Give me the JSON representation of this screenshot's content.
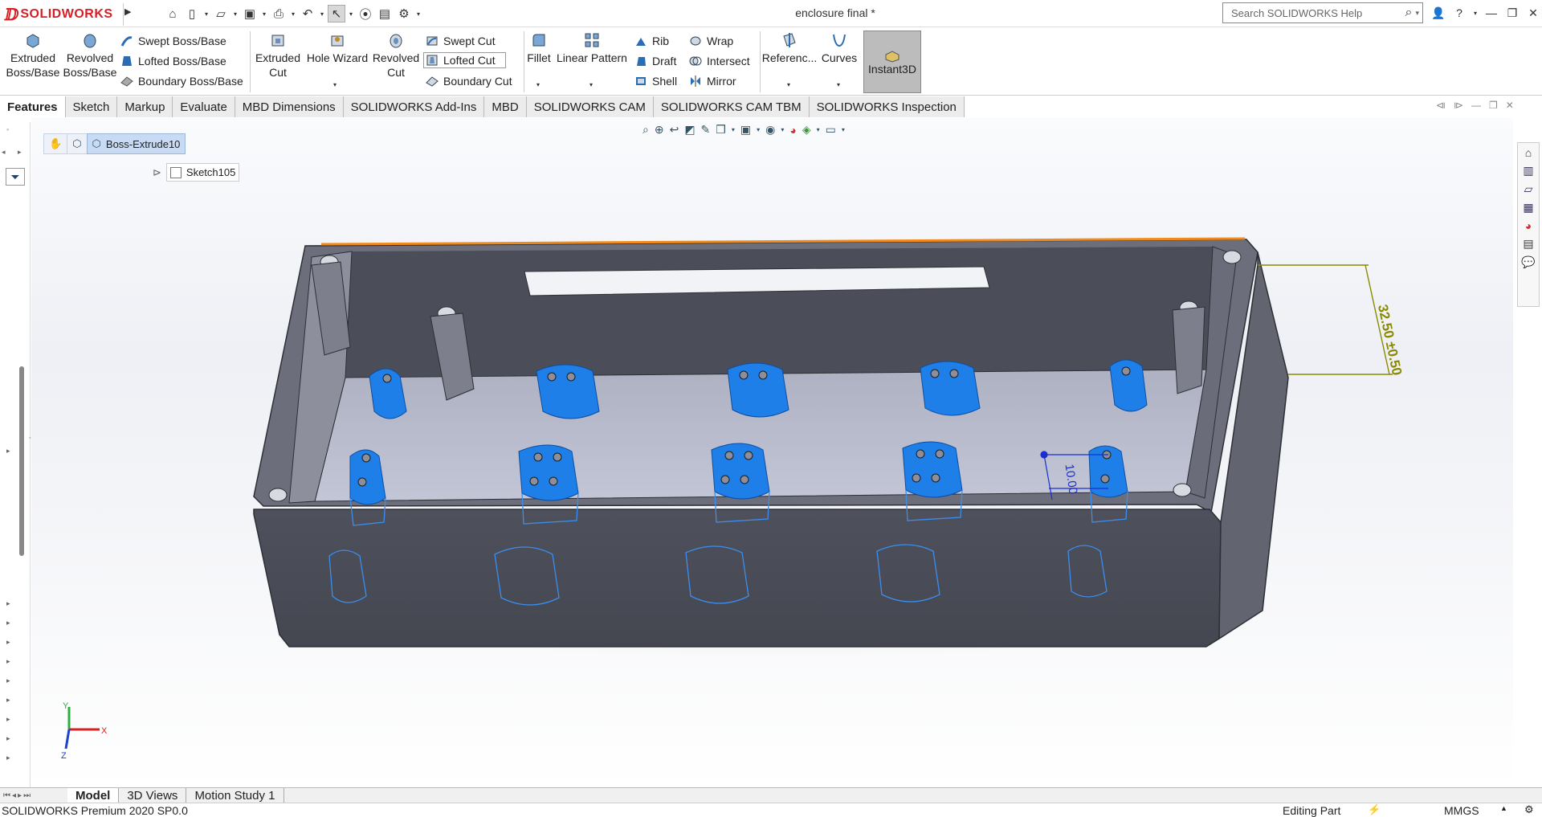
{
  "app": {
    "brand": "SOLIDWORKS",
    "title": "enclosure final *"
  },
  "search": {
    "placeholder": "Search SOLIDWORKS Help"
  },
  "ribbon": {
    "extruded_boss": [
      "Extruded",
      "Boss/Base"
    ],
    "revolved_boss": [
      "Revolved",
      "Boss/Base"
    ],
    "swept_boss": "Swept Boss/Base",
    "lofted_boss": "Lofted Boss/Base",
    "boundary_boss": "Boundary Boss/Base",
    "extruded_cut": [
      "Extruded",
      "Cut"
    ],
    "hole_wizard": "Hole Wizard",
    "revolved_cut": [
      "Revolved",
      "Cut"
    ],
    "swept_cut": "Swept Cut",
    "lofted_cut": "Lofted Cut",
    "boundary_cut": "Boundary Cut",
    "fillet": "Fillet",
    "linear_pattern": "Linear Pattern",
    "rib": "Rib",
    "draft": "Draft",
    "shell": "Shell",
    "wrap": "Wrap",
    "intersect": "Intersect",
    "mirror": "Mirror",
    "reference": "Referenc...",
    "curves": "Curves",
    "instant3d": "Instant3D"
  },
  "tabs": [
    "Features",
    "Sketch",
    "Markup",
    "Evaluate",
    "MBD Dimensions",
    "SOLIDWORKS Add-Ins",
    "MBD",
    "SOLIDWORKS CAM",
    "SOLIDWORKS CAM TBM",
    "SOLIDWORKS Inspection"
  ],
  "breadcrumb": {
    "feature": "Boss-Extrude10"
  },
  "tree": {
    "sketch": "Sketch105"
  },
  "dimensions": {
    "height": "32.50 ±0.50",
    "spacing": "10.00"
  },
  "triad": {
    "x": "X",
    "y": "Y",
    "z": "Z"
  },
  "bottom_tabs": [
    "Model",
    "3D Views",
    "Motion Study 1"
  ],
  "status": {
    "version": "SOLIDWORKS Premium 2020 SP0.0",
    "mode": "Editing Part",
    "units": "MMGS"
  },
  "colors": {
    "accent": "#d71f26",
    "body": "#4d505c",
    "selected": "#1f7fe8",
    "edge_highlight": "#f08a1c",
    "dimension": "#8a8a00"
  }
}
